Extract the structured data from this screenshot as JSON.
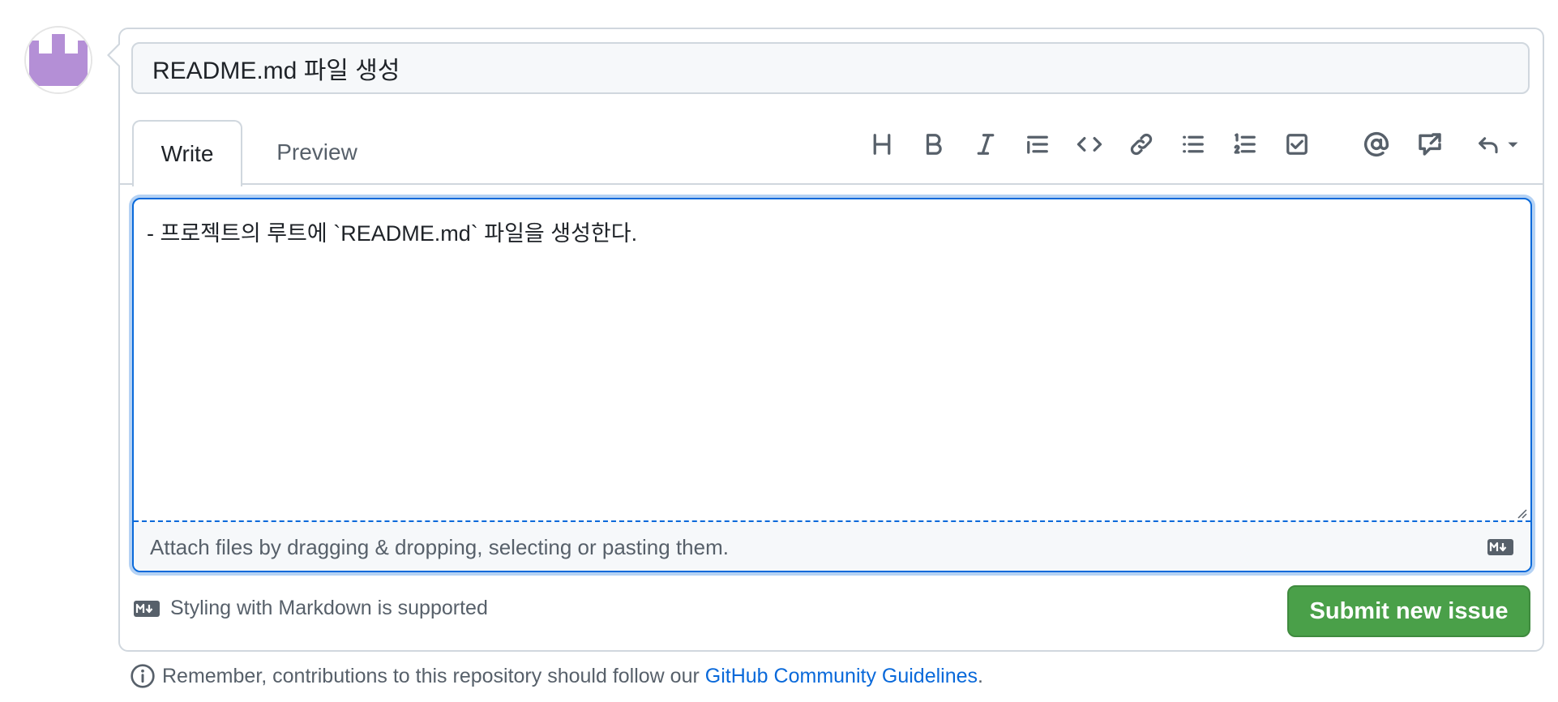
{
  "issue": {
    "title_value": "README.md 파일 생성",
    "tabs": [
      {
        "label": "Write",
        "active": true
      },
      {
        "label": "Preview",
        "active": false
      }
    ],
    "toolbar": [
      {
        "icon": "heading-icon"
      },
      {
        "icon": "bold-icon"
      },
      {
        "icon": "italic-icon"
      },
      {
        "icon": "quote-icon"
      },
      {
        "icon": "code-icon"
      },
      {
        "icon": "link-icon"
      },
      {
        "icon": "unordered-list-icon"
      },
      {
        "icon": "ordered-list-icon"
      },
      {
        "icon": "task-list-icon"
      },
      {
        "icon": "mention-icon"
      },
      {
        "icon": "reference-icon"
      },
      {
        "icon": "reply-icon"
      }
    ],
    "body_value": "- 프로젝트의 루트에 `README.md` 파일을 생성한다.",
    "attach_text": "Attach files by dragging & dropping, selecting or pasting them.",
    "markdown_note": "Styling with Markdown is supported",
    "submit_label": "Submit new issue",
    "guidelines_prefix": "Remember, contributions to this repository should follow our",
    "guidelines_link": "GitHub Community Guidelines",
    "guidelines_suffix": "."
  },
  "colors": {
    "accent": "#0969da",
    "submit": "#4aa049",
    "avatar": "#b48fd6"
  }
}
